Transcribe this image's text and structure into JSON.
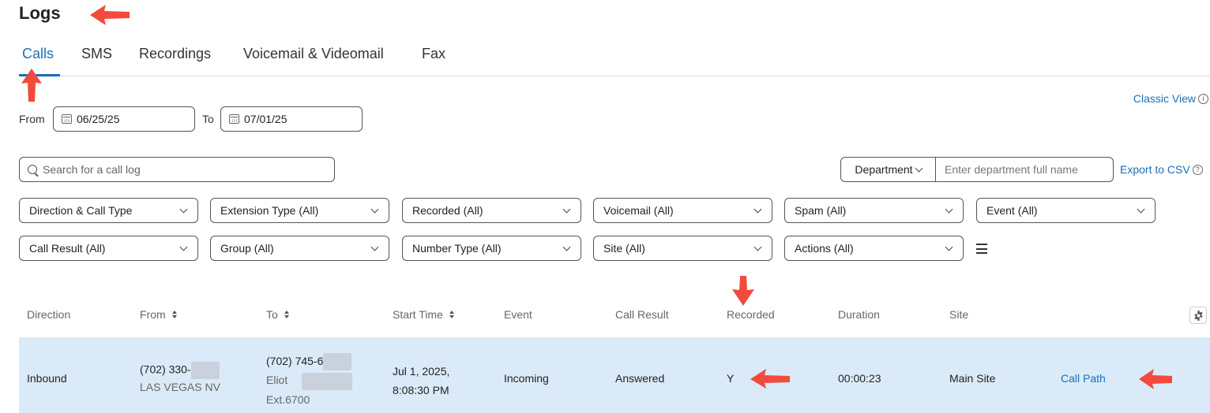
{
  "page": {
    "title": "Logs"
  },
  "tabs": [
    {
      "label": "Calls",
      "active": true
    },
    {
      "label": "SMS"
    },
    {
      "label": "Recordings"
    },
    {
      "label": "Voicemail & Videomail"
    },
    {
      "label": "Fax"
    }
  ],
  "classic_view": {
    "label": "Classic View"
  },
  "date_range": {
    "from_label": "From",
    "from_value": "06/25/25",
    "to_label": "To",
    "to_value": "07/01/25"
  },
  "search": {
    "placeholder": "Search for a call log",
    "value": ""
  },
  "department": {
    "select_label": "Department",
    "input_placeholder": "Enter department full name"
  },
  "export": {
    "label": "Export to CSV"
  },
  "filters": {
    "row1": [
      "Direction & Call Type",
      "Extension Type (All)",
      "Recorded (All)",
      "Voicemail (All)",
      "Spam (All)",
      "Event (All)"
    ],
    "row2": [
      "Call Result (All)",
      "Group (All)",
      "Number Type (All)",
      "Site (All)",
      "Actions (All)"
    ]
  },
  "table": {
    "columns": [
      "Direction",
      "From",
      "To",
      "Start Time",
      "Event",
      "Call Result",
      "Recorded",
      "Duration",
      "Site"
    ],
    "rows": [
      {
        "direction": "Inbound",
        "from_number": "(702) 330-",
        "from_location": "LAS VEGAS NV",
        "to_number": "(702) 745-6",
        "to_name": "Eliot",
        "to_ext": "Ext.6700",
        "start_date": "Jul 1, 2025,",
        "start_time": "8:08:30 PM",
        "event": "Incoming",
        "call_result": "Answered",
        "recorded": "Y",
        "duration": "00:00:23",
        "site": "Main Site",
        "action": "Call Path"
      }
    ]
  },
  "colors": {
    "accent": "#1a6fb5",
    "row_highlight": "#dbeaf8",
    "annotation_arrow": "#f24a3c"
  },
  "icons": [
    "calendar-icon",
    "search-icon",
    "chevron-down-icon",
    "info-icon",
    "question-icon",
    "hamburger-menu-icon",
    "gear-icon",
    "sort-icon"
  ]
}
